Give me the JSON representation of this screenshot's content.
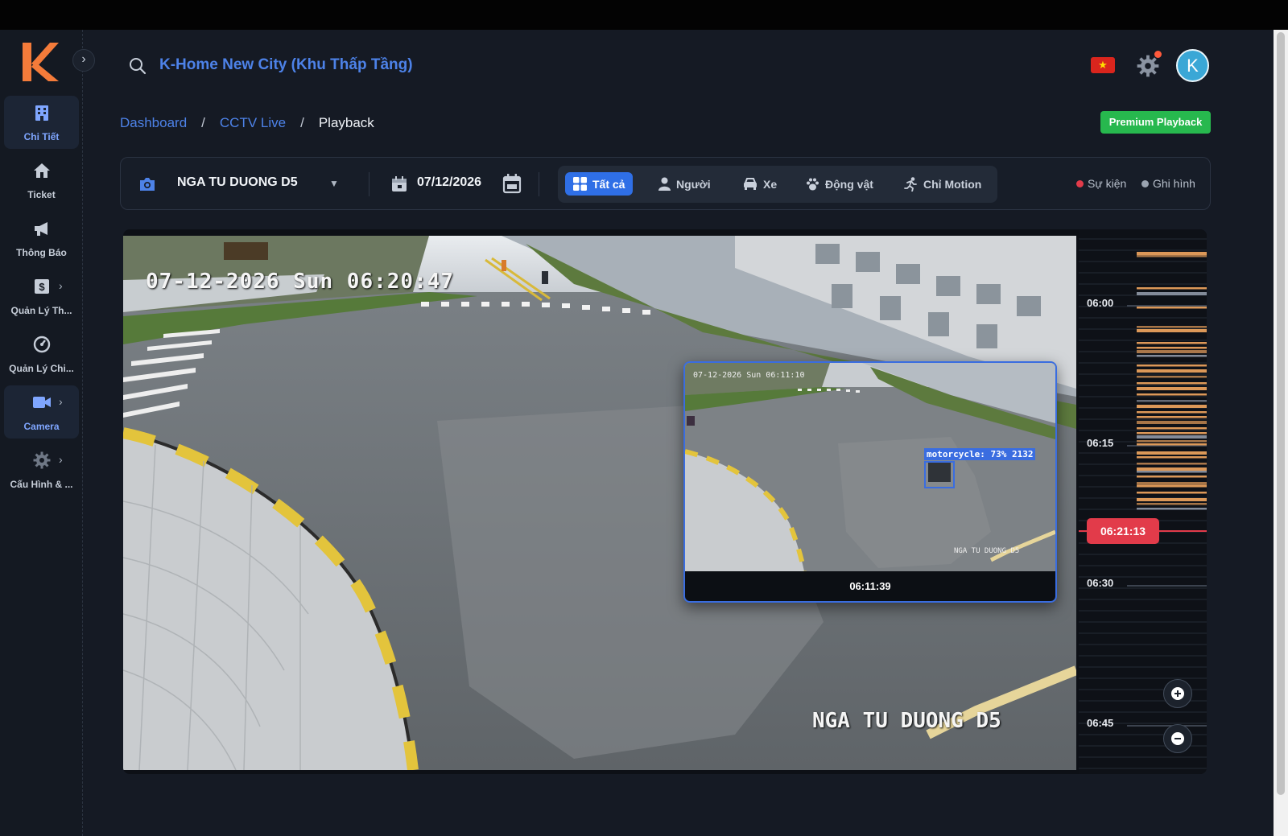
{
  "header": {
    "project_title": "K-Home New City (Khu Thấp Tầng)",
    "avatar_initial": "K"
  },
  "sidebar": {
    "items": [
      {
        "label": "Chi Tiết",
        "icon": "building-icon",
        "active": true
      },
      {
        "label": "Ticket",
        "icon": "home-icon"
      },
      {
        "label": "Thông Báo",
        "icon": "megaphone-icon"
      },
      {
        "label": "Quản Lý Th...",
        "icon": "dollar-icon"
      },
      {
        "label": "Quản Lý Chi...",
        "icon": "gauge-icon"
      },
      {
        "label": "Camera",
        "icon": "video-icon",
        "active": true
      },
      {
        "label": "Cấu Hình & ...",
        "icon": "gear-icon"
      }
    ]
  },
  "breadcrumb": {
    "items": [
      "Dashboard",
      "CCTV Live",
      "Playback"
    ],
    "separator": "/"
  },
  "premium_badge": "Premium Playback",
  "toolbar": {
    "camera_name": "NGA TU DUONG D5",
    "date": "07/12/2026",
    "filters": [
      "Tất cả",
      "Người",
      "Xe",
      "Động vật",
      "Chỉ Motion"
    ],
    "active_filter": "Tất cả",
    "legend": [
      {
        "label": "Sự kiện",
        "color": "#e23b4a"
      },
      {
        "label": "Ghi hình",
        "color": "#9aa3b0"
      }
    ]
  },
  "video": {
    "osd_timestamp": "07-12-2026 Sun 06:20:47",
    "osd_camera": "NGA TU DUONG D5"
  },
  "preview": {
    "osd_timestamp": "07-12-2026 Sun 06:11:10",
    "osd_camera": "NGA TU DUONG D5",
    "detection_label": "motorcycle: 73% 2132",
    "time": "06:11:39"
  },
  "timeline": {
    "labels": [
      "06:00",
      "06:15",
      "06:30",
      "06:45"
    ],
    "current_time": "06:21:13",
    "event_color": "#e8a05c",
    "recording_color": "#8a92a0"
  }
}
